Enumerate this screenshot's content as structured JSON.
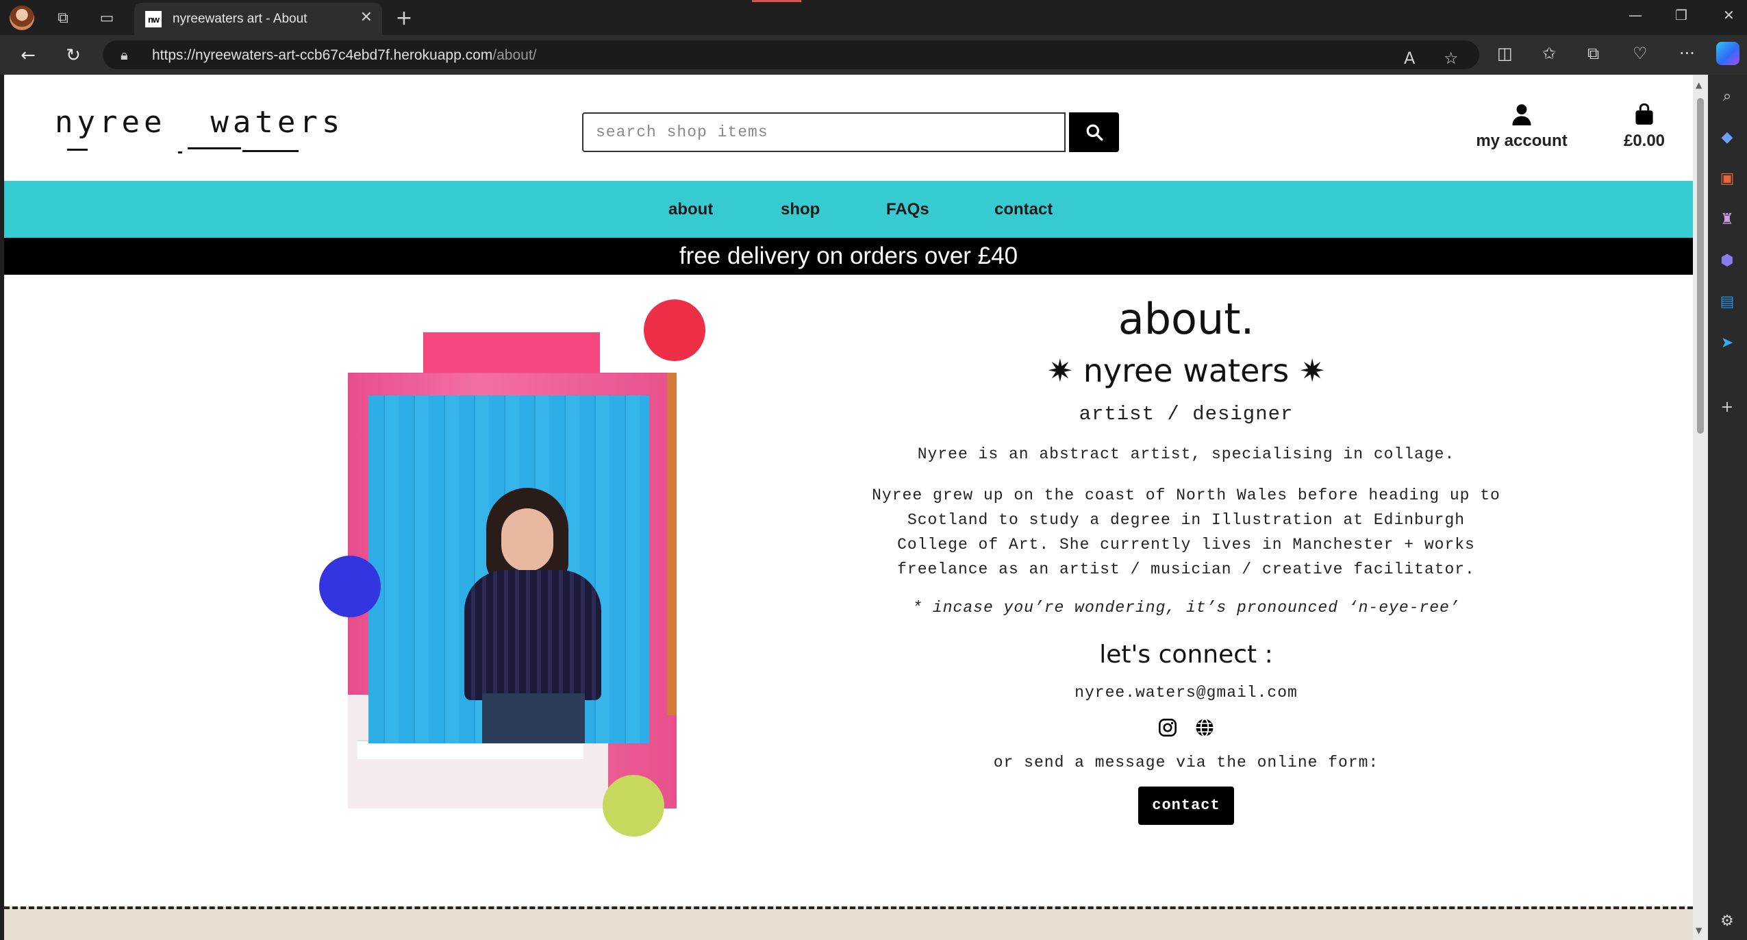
{
  "browser": {
    "tab_title": "nyreewaters art - About",
    "tab_favicon": "nw",
    "url_main": "https://nyreewaters-art-ccb67c4ebd7f.herokuapp.com",
    "url_path": "/about/"
  },
  "header": {
    "logo_text": "nyree  waters",
    "search_placeholder": "search shop items",
    "account_label": "my account",
    "basket_total": "£0.00"
  },
  "nav": {
    "items": [
      "about",
      "shop",
      "FAQs",
      "contact"
    ]
  },
  "promo": {
    "text": "free delivery on orders over £40"
  },
  "about": {
    "heading": "about.",
    "name": "✷ nyree waters ✷",
    "role": "artist / designer",
    "intro": "Nyree is an abstract artist, specialising in collage.",
    "bio": "Nyree grew up on the coast of North Wales before heading up to Scotland to study a degree in Illustration at Edinburgh College of Art. She currently lives in Manchester + works freelance as an artist / musician / creative facilitator.",
    "note": "* incase you’re wondering, it’s pronounced ‘n-eye-ree’",
    "connect_heading": "let's connect :",
    "email": "nyree.waters@gmail.com",
    "form_prompt": "or send a message via the online form:",
    "contact_button": "contact"
  },
  "colors": {
    "nav_bg": "#36cbd0",
    "promo_bg": "#000000",
    "dot_red": "#ef2e48",
    "dot_blue": "#3335e0",
    "dot_green": "#c7d95c",
    "footer_bg": "#e8dfd3"
  },
  "icons": [
    "user-icon",
    "shopping-bag-icon",
    "search-icon",
    "instagram-icon",
    "globe-icon"
  ]
}
